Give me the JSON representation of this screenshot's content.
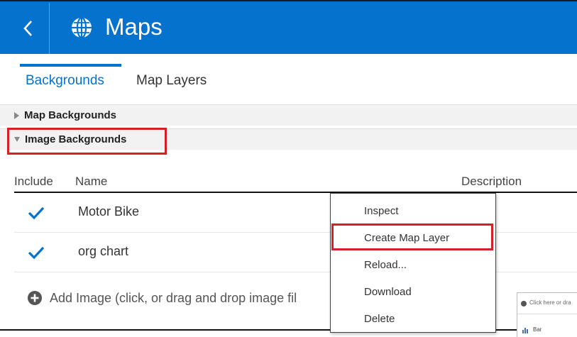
{
  "header": {
    "title": "Maps",
    "icon": "globe-icon",
    "background_color": "#0572ce"
  },
  "tabs": [
    {
      "label": "Backgrounds",
      "active": true
    },
    {
      "label": "Map Layers",
      "active": false
    }
  ],
  "sections": {
    "map_backgrounds": {
      "label": "Map Backgrounds",
      "expanded": false
    },
    "image_backgrounds": {
      "label": "Image Backgrounds",
      "expanded": true
    }
  },
  "table": {
    "columns": [
      "Include",
      "Name",
      "Description"
    ],
    "rows": [
      {
        "include": true,
        "name": "Motor Bike"
      },
      {
        "include": true,
        "name": "org chart"
      }
    ],
    "add_label": "Add Image (click, or drag and drop image fil"
  },
  "context_menu": {
    "items": [
      "Inspect",
      "Create Map Layer",
      "Reload...",
      "Download",
      "Delete"
    ],
    "highlighted_item": "Create Map Layer"
  },
  "thumbnail": {
    "hint_text": "Click here or dra",
    "bar_label": "Bar"
  },
  "colors": {
    "accent": "#0572ce",
    "highlight_border": "#d62027"
  }
}
